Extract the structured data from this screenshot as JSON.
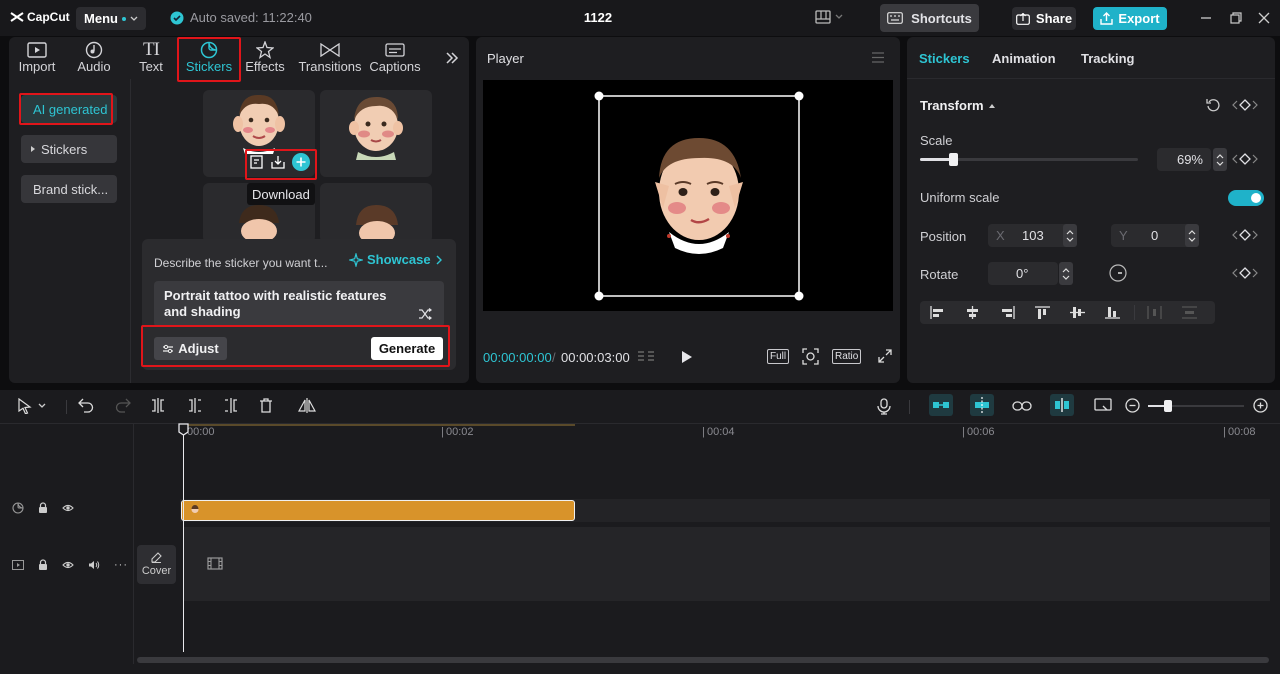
{
  "topbar": {
    "logo": "CapCut",
    "menu_label": "Menu",
    "autosave": "Auto saved: 11:22:40",
    "project_title": "1122",
    "shortcuts_label": "Shortcuts",
    "share_label": "Share",
    "export_label": "Export"
  },
  "toolbar": {
    "tabs": [
      "Import",
      "Audio",
      "Text",
      "Stickers",
      "Effects",
      "Transitions",
      "Captions"
    ],
    "active_tab": "Stickers"
  },
  "sticker_sidebar": {
    "items": [
      "AI generated",
      "Stickers",
      "Brand stick..."
    ]
  },
  "sticker_grid": {
    "tooltip": "Download"
  },
  "generator": {
    "prompt_label": "Describe the sticker you want t...",
    "showcase_label": "Showcase",
    "prompt_text": "Portrait tattoo with realistic features and shading",
    "adjust_label": "Adjust",
    "generate_label": "Generate"
  },
  "player": {
    "title": "Player",
    "current_time": "00:00:00:00",
    "total_time": "00:00:03:00",
    "full_label": "Full",
    "ratio_label": "Ratio"
  },
  "properties": {
    "tabs": [
      "Stickers",
      "Animation",
      "Tracking"
    ],
    "active_tab": "Stickers",
    "section_title": "Transform",
    "scale_label": "Scale",
    "scale_value": "69%",
    "scale_fraction": 0.69,
    "uniform_label": "Uniform scale",
    "uniform_on": true,
    "position_label": "Position",
    "x_label": "X",
    "x_value": "103",
    "y_label": "Y",
    "y_value": "0",
    "rotate_label": "Rotate",
    "rotate_value": "0°"
  },
  "timeline": {
    "ruler": [
      "00:00",
      "00:02",
      "00:04",
      "00:06",
      "00:08"
    ],
    "cover_label": "Cover"
  },
  "colors": {
    "accent": "#2ec5d3",
    "highlight": "#e0151a",
    "clip": "#d8932a",
    "export": "#1fb2c9"
  }
}
